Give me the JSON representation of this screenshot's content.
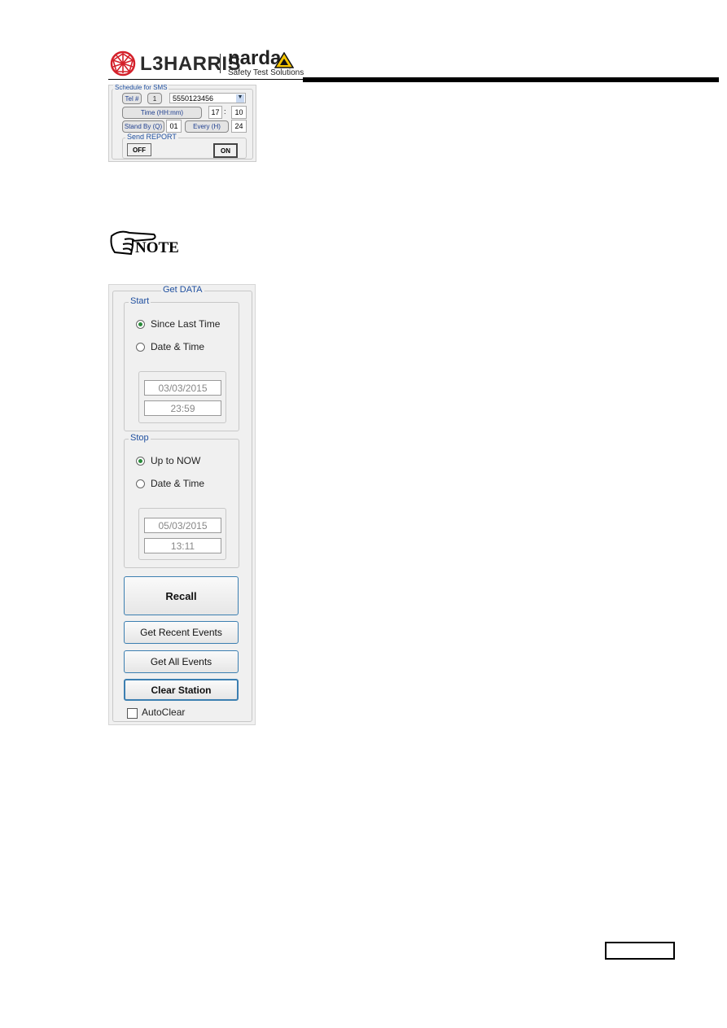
{
  "header": {
    "brand1": "L3HARRIS",
    "brand2": "narda",
    "tagline": "Safety Test Solutions"
  },
  "sms": {
    "title": "Schedule for SMS",
    "tel_label": "Tel #",
    "tel_index": "1",
    "tel_number": "5550123456",
    "time_label": "Time (HH:mm)",
    "hour": "17",
    "sep": ":",
    "minute": "10",
    "standby_label": "Stand By (Q)",
    "standby_value": "01",
    "every_label": "Every (H)",
    "every_value": "24",
    "report_title": "Send REPORT",
    "off": "OFF",
    "on": "ON"
  },
  "note": {
    "label": "NOTE"
  },
  "getdata": {
    "title": "Get DATA",
    "start": {
      "title": "Start",
      "opt1": "Since Last Time",
      "opt2": "Date & Time",
      "selected": "Since Last Time",
      "date": "03/03/2015",
      "time": "23:59"
    },
    "stop": {
      "title": "Stop",
      "opt1": "Up to NOW",
      "opt2": "Date & Time",
      "selected": "Up to NOW",
      "date": "05/03/2015",
      "time": "13:11"
    },
    "recall": "Recall",
    "recent": "Get Recent Events",
    "all": "Get All Events",
    "clear": "Clear Station",
    "autoclear": "AutoClear",
    "autoclear_checked": false
  }
}
